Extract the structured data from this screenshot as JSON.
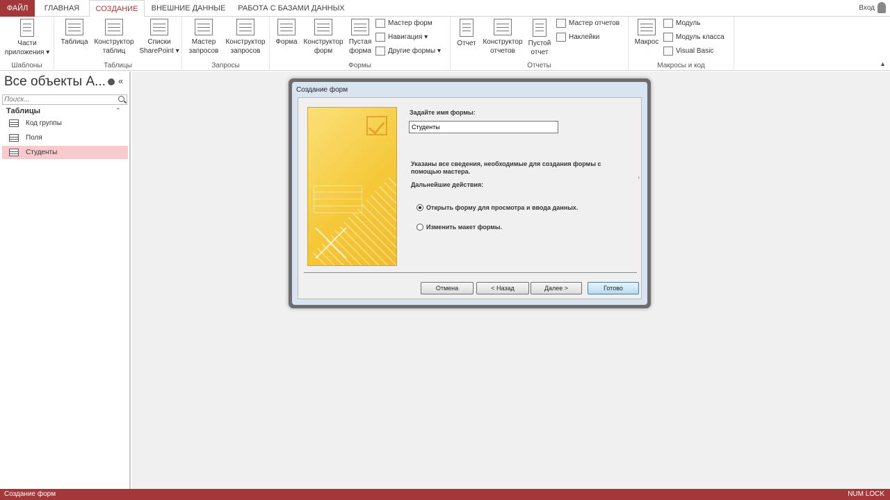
{
  "tabs": {
    "file": "ФАЙЛ",
    "home": "ГЛАВНАЯ",
    "create": "СОЗДАНИЕ",
    "external": "ВНЕШНИЕ ДАННЫЕ",
    "dbtools": "РАБОТА С БАЗАМИ ДАННЫХ"
  },
  "signin": "Вход",
  "ribbon": {
    "templates": {
      "label": "Шаблоны",
      "app_parts": "Части приложения ▾"
    },
    "tables": {
      "label": "Таблицы",
      "table": "Таблица",
      "designer": "Конструктор таблиц",
      "sharepoint": "Списки SharePoint ▾"
    },
    "queries": {
      "label": "Запросы",
      "wizard": "Мастер запросов",
      "designer": "Конструктор запросов"
    },
    "forms": {
      "label": "Формы",
      "form": "Форма",
      "designer": "Конструктор форм",
      "blank": "Пустая форма",
      "wizard": "Мастер форм",
      "navigation": "Навигация ▾",
      "more": "Другие формы ▾"
    },
    "reports": {
      "label": "Отчеты",
      "report": "Отчет",
      "designer": "Конструктор отчетов",
      "blank": "Пустой отчет",
      "wizard": "Мастер отчетов",
      "labels": "Наклейки"
    },
    "macros": {
      "label": "Макросы и код",
      "macro": "Макрос",
      "module": "Модуль",
      "class_module": "Модуль класса",
      "vb": "Visual Basic"
    }
  },
  "nav": {
    "title": "Все объекты A...",
    "search_placeholder": "Поиск...",
    "group": "Таблицы",
    "items": [
      {
        "label": "Код группы",
        "selected": false
      },
      {
        "label": "Поля",
        "selected": false
      },
      {
        "label": "Студенты",
        "selected": true
      }
    ]
  },
  "dialog": {
    "title": "Создание форм",
    "name_prompt": "Задайте имя формы:",
    "name_value": "Студенты",
    "info": "Указаны все сведения, необходимые для создания формы с помощью мастера.",
    "next_actions": "Дальнейшие действия:",
    "option_open": "Открыть форму для просмотра и ввода данных.",
    "option_modify": "Изменить макет формы.",
    "selected_option": "open",
    "buttons": {
      "cancel": "Отмена",
      "back": "< Назад",
      "next": "Далее >",
      "finish": "Готово"
    }
  },
  "status": {
    "left": "Создание форм",
    "right": "NUM LOCK"
  },
  "colors": {
    "accent": "#a4373a",
    "selected_row": "#f8c9cd",
    "wizard_art": "#f5c93a"
  }
}
